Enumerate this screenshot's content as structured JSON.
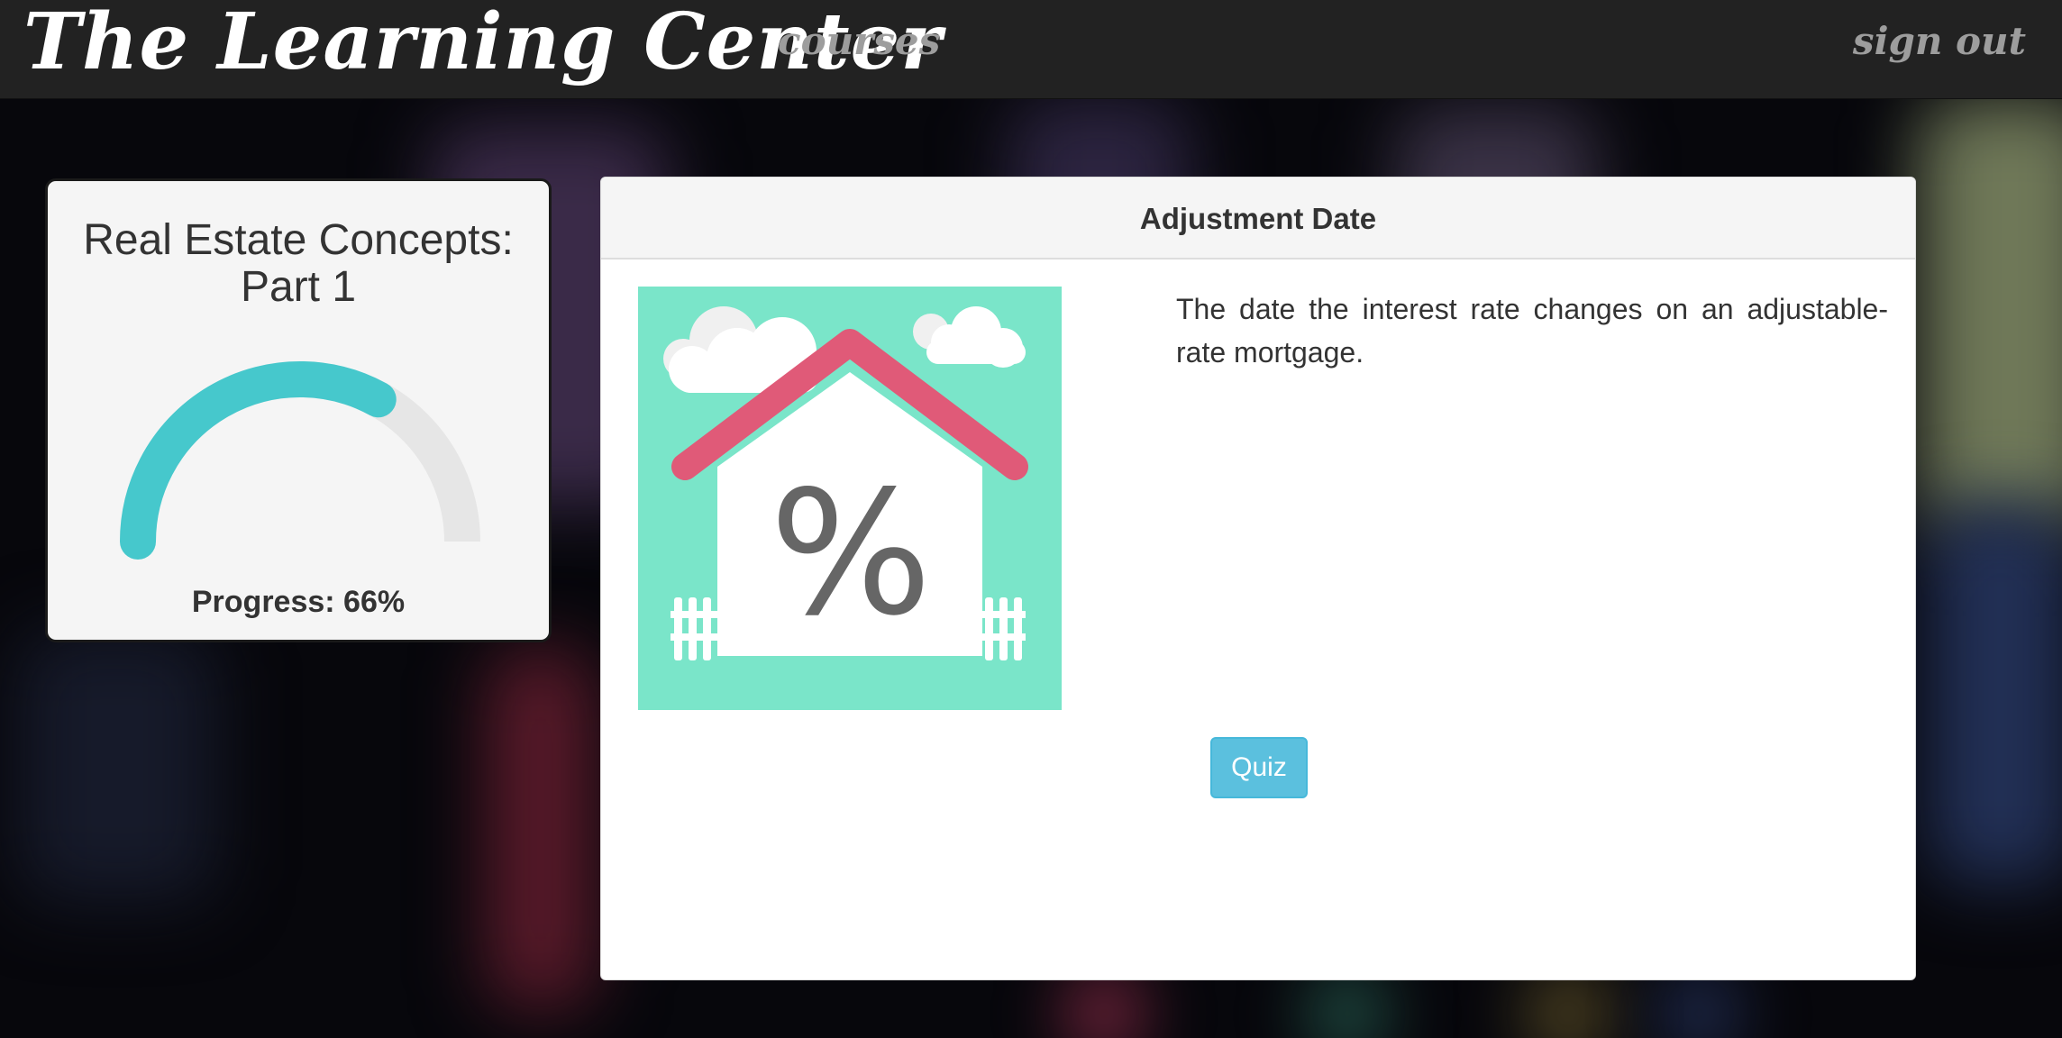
{
  "app": {
    "brand": "The Learning Center"
  },
  "nav": {
    "courses_label": "courses",
    "signout_label": "sign out"
  },
  "course": {
    "title_line1": "Real Estate Concepts:",
    "title_line2": "Part 1",
    "progress_label": "Progress: 66%",
    "progress_fraction": 0.66,
    "gauge_fill_color": "#46c8cc",
    "gauge_track_color": "#e6e6e6"
  },
  "lesson": {
    "heading": "Adjustment Date",
    "description": "The date the interest rate changes on an adjustable-rate mortgage.",
    "image": {
      "icon": "house-percent-icon",
      "symbol": "%",
      "background_color": "#7ae5c9",
      "roof_color": "#e05a78"
    },
    "quiz_label": "Quiz"
  },
  "colors": {
    "navbar": "#222222",
    "nav_link": "#9d9d9d",
    "quiz_button": "#5bc0de"
  }
}
